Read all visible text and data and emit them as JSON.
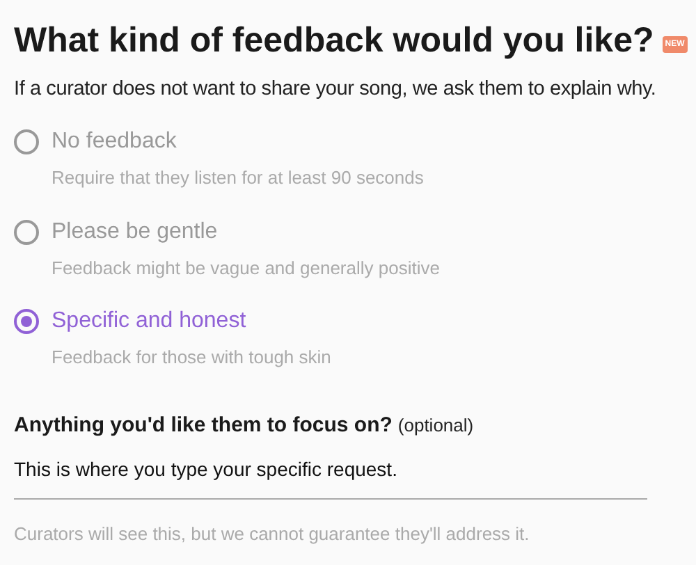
{
  "title": "What kind of feedback would you like?",
  "badge": "NEW",
  "intro": "If a curator does not want to share your song, we ask them to explain why.",
  "options": [
    {
      "label": "No feedback",
      "description": "Require that they listen for at least 90 seconds",
      "selected": false
    },
    {
      "label": "Please be gentle",
      "description": "Feedback might be vague and generally positive",
      "selected": false
    },
    {
      "label": "Specific and honest",
      "description": "Feedback for those with tough skin",
      "selected": true
    }
  ],
  "focus": {
    "question": "Anything you'd like them to focus on?",
    "note": "(optional)",
    "value": "This is where you type your specific request.",
    "help": "Curators will see this, but we cannot guarantee they'll address it."
  }
}
